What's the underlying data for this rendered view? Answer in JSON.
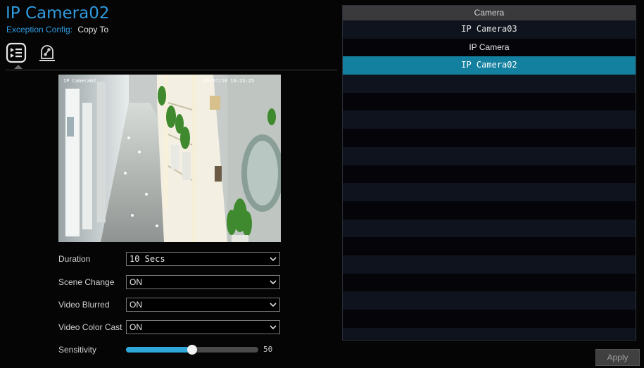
{
  "header": {
    "title": "IP Camera02",
    "config_label": "Exception Config:",
    "copy_to_label": "Copy To"
  },
  "tabs": [
    {
      "icon": "list-icon",
      "active": true
    },
    {
      "icon": "alarm-siren-icon",
      "active": false
    }
  ],
  "preview": {
    "osd_name": "IP Camera02",
    "osd_time": "09/07/18 16:23:25"
  },
  "settings": {
    "duration": {
      "label": "Duration",
      "value": "10 Secs"
    },
    "scene_change": {
      "label": "Scene Change",
      "value": "ON"
    },
    "video_blurred": {
      "label": "Video Blurred",
      "value": "ON"
    },
    "video_color_cast": {
      "label": "Video Color Cast",
      "value": "ON"
    },
    "sensitivity": {
      "label": "Sensitivity",
      "value": "50",
      "level_fraction": 0.5
    }
  },
  "camera_list": {
    "header": "Camera",
    "items": [
      {
        "label": "IP Camera03",
        "selected": false
      },
      {
        "label": "IP Camera",
        "selected": false
      },
      {
        "label": "IP Camera02",
        "selected": true
      }
    ]
  },
  "apply_label": "Apply",
  "colors": {
    "accent": "#2f9be0",
    "selection": "#13809f",
    "slider_fill": "#2fa7d8"
  }
}
